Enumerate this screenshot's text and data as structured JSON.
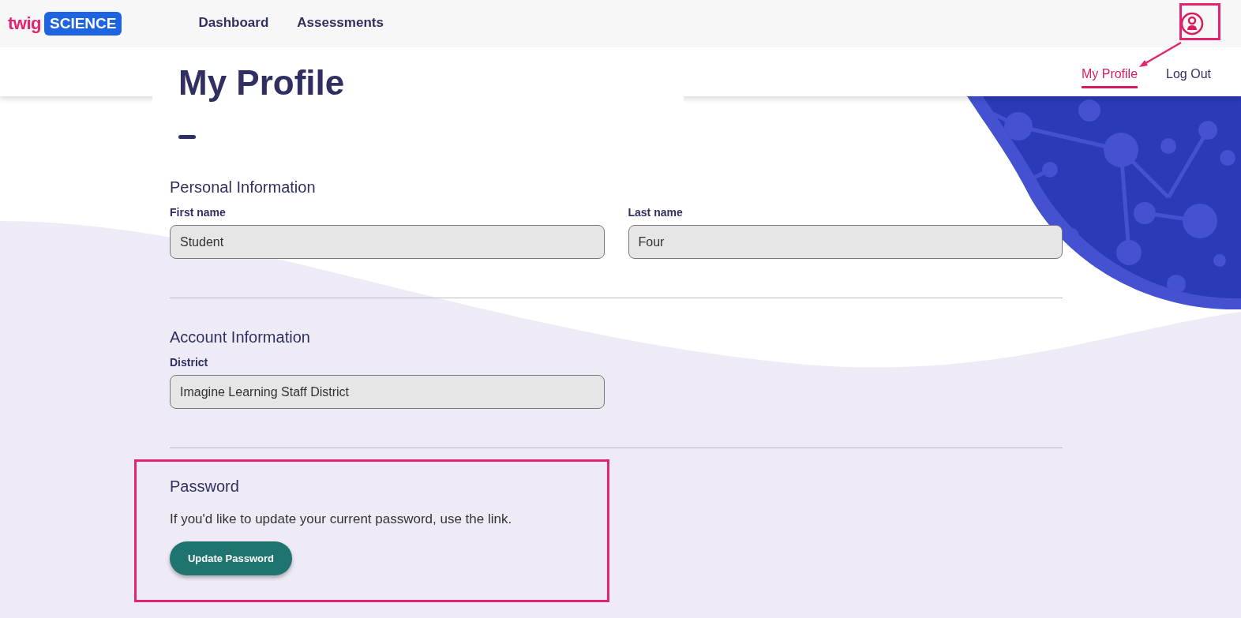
{
  "logo": {
    "word": "twig",
    "badge": "SCIENCE"
  },
  "main_nav": [
    {
      "label": "Dashboard",
      "selected": false
    },
    {
      "label": "Assessments",
      "selected": false
    }
  ],
  "sub_nav": [
    {
      "label": "My Profile",
      "selected": true
    },
    {
      "label": "Log Out",
      "selected": false
    }
  ],
  "page_title": "My Profile",
  "sections": [
    {
      "heading": "Personal Information",
      "fields": [
        {
          "label": "First name",
          "value": "Student"
        },
        {
          "label": "Last name",
          "value": "Four"
        }
      ]
    },
    {
      "heading": "Account Information",
      "fields": [
        {
          "label": "District",
          "value": "Imagine Learning Staff District"
        }
      ]
    }
  ],
  "password": {
    "heading": "Password",
    "text": "If you'd like to update your current password, use the link.",
    "button": "Update Password"
  }
}
